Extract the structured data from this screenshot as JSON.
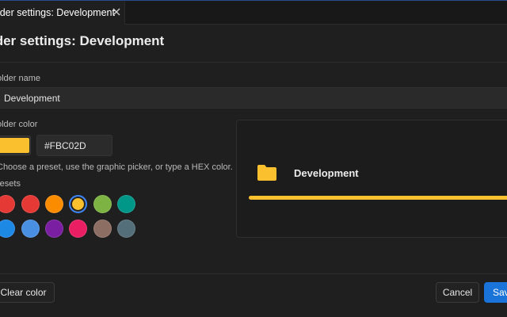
{
  "tab": {
    "label": "older settings: Development",
    "close_icon": "close-icon"
  },
  "heading": "lder settings: Development",
  "folder_name": {
    "label": "older name",
    "value": "Development"
  },
  "folder_color": {
    "label": "older color",
    "hex_value": "#FBC02D",
    "swatch_color": "#FBC02D",
    "hint": "Choose a preset, use the graphic picker, or type a HEX color."
  },
  "presets": {
    "label": "resets",
    "colors": [
      "#E53935",
      "#E53935",
      "#FB8C00",
      "#FBC02D",
      "#7CB342",
      "#009688",
      "#1E88E5",
      "#4A90E2",
      "#7B1FA2",
      "#E91E63",
      "#8D6E63",
      "#546E7A"
    ],
    "selected_index": 3
  },
  "preview": {
    "name": "Development",
    "folder_icon": "folder-icon",
    "color": "#FBC02D"
  },
  "footer": {
    "clear_label": "Clear color",
    "cancel_label": "Cancel",
    "save_label": "Save"
  }
}
